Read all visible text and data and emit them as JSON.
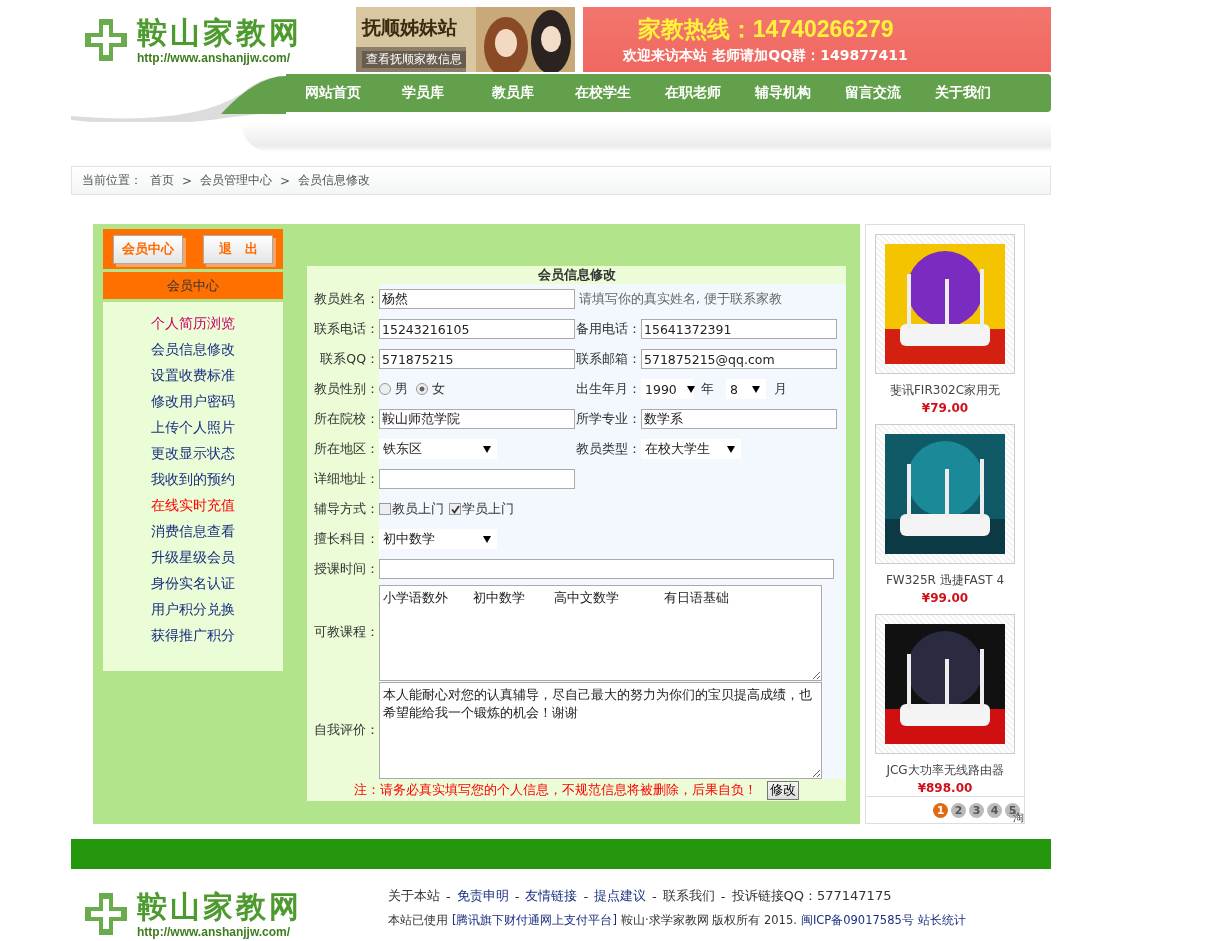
{
  "header": {
    "logo": {
      "title": "鞍山家教网",
      "url": "http://www.anshanjjw.com/"
    },
    "banners": [
      {
        "kind": "picture",
        "title": "抚顺姊妹站",
        "subtitle": "查看抚顺家教信息"
      },
      {
        "kind": "hotline",
        "title": "家教热线：14740266279",
        "subtitle": "欢迎来访本站 老师请加QQ群：149877411"
      }
    ]
  },
  "nav": [
    "网站首页",
    "学员库",
    "教员库",
    "在校学生",
    "在职老师",
    "辅导机构",
    "留言交流",
    "关于我们"
  ],
  "breadcrumb": {
    "prefix": "当前位置：",
    "separator": ">",
    "items": [
      "首页",
      "会员管理中心",
      "会员信息修改"
    ]
  },
  "member_menu": {
    "buttons": [
      "会员中心",
      "退　出"
    ],
    "title": "会员中心",
    "items": [
      {
        "label": "个人简历浏览",
        "color": "#cc0066"
      },
      {
        "label": "会员信息修改",
        "color": "#1a2f80"
      },
      {
        "label": "设置收费标准",
        "color": "#1a2f80"
      },
      {
        "label": "修改用户密码",
        "color": "#1a2f80"
      },
      {
        "label": "上传个人照片",
        "color": "#1a2f80"
      },
      {
        "label": "更改显示状态",
        "color": "#1a2f80"
      },
      {
        "label": "我收到的预约",
        "color": "#1a2f80"
      },
      {
        "label": "在线实时充值",
        "color": "#ff0000"
      },
      {
        "label": "消费信息查看",
        "color": "#1a2f80"
      },
      {
        "label": "升级星级会员",
        "color": "#1a2f80"
      },
      {
        "label": "身份实名认证",
        "color": "#1a2f80"
      },
      {
        "label": "用户积分兑换",
        "color": "#1a2f80"
      },
      {
        "label": "获得推广积分",
        "color": "#1a2f80"
      }
    ]
  },
  "form": {
    "title": "会员信息修改",
    "rows": [
      {
        "cells": [
          {
            "kind": "text",
            "label": "教员姓名：",
            "value": "杨然"
          },
          {
            "kind": "hint",
            "text": "请填写你的真实姓名, 便于联系家教"
          }
        ]
      },
      {
        "cells": [
          {
            "kind": "text",
            "label": "联系电话：",
            "value": "15243216105"
          },
          {
            "kind": "text",
            "label": "备用电话：",
            "value": "15641372391"
          }
        ]
      },
      {
        "cells": [
          {
            "kind": "text",
            "label": "联系QQ：",
            "value": "571875215"
          },
          {
            "kind": "text",
            "label": "联系邮箱：",
            "value": "571875215@qq.com"
          }
        ]
      },
      {
        "cells": [
          {
            "kind": "radio",
            "label": "教员性别：",
            "options": [
              {
                "label": "男",
                "selected": false
              },
              {
                "label": "女",
                "selected": true
              }
            ]
          },
          {
            "kind": "date",
            "label": "出生年月：",
            "year": "1990",
            "year_unit": "年",
            "month": "8",
            "month_unit": "月"
          }
        ]
      },
      {
        "cells": [
          {
            "kind": "text",
            "label": "所在院校：",
            "value": "鞍山师范学院"
          },
          {
            "kind": "text",
            "label": "所学专业：",
            "value": "数学系"
          }
        ]
      },
      {
        "cells": [
          {
            "kind": "select",
            "label": "所在地区：",
            "value": "铁东区"
          },
          {
            "kind": "select",
            "label": "教员类型：",
            "value": "在校大学生"
          }
        ]
      },
      {
        "cells": [
          {
            "kind": "text",
            "label": "详细地址："
          }
        ]
      },
      {
        "cells": [
          {
            "kind": "checkbox",
            "label": "辅导方式：",
            "options": [
              {
                "label": "教员上门",
                "checked": false
              },
              {
                "label": "学员上门",
                "checked": true
              }
            ]
          }
        ]
      },
      {
        "cells": [
          {
            "kind": "select",
            "label": "擅长科目：",
            "value": "初中数学"
          }
        ]
      },
      {
        "cells": [
          {
            "kind": "wide",
            "label": "授课时间："
          }
        ]
      },
      {
        "cells": [
          {
            "kind": "textarea",
            "label": "可教课程：",
            "value": "小学语数外      初中数学       高中文数学           有日语基础"
          }
        ]
      },
      {
        "cells": [
          {
            "kind": "textarea",
            "label": "自我评价：",
            "value": "本人能耐心对您的认真辅导，尽自己最大的努力为你们的宝贝提高成绩，也希望能给我一个锻炼的机会！谢谢"
          }
        ]
      }
    ],
    "note": "注：请务必真实填写您的个人信息，不规范信息将被删除，后果自负！",
    "submit": "修改"
  },
  "products": [
    {
      "kind": "picture",
      "name": "斐讯FIR302C家用无",
      "price": "¥79.00"
    },
    {
      "kind": "picture",
      "name": "FW325R 迅捷FAST 4",
      "price": "¥99.00"
    },
    {
      "kind": "picture",
      "name": "JCG大功率无线路由器",
      "price": "¥898.00"
    }
  ],
  "pager": {
    "pages": [
      {
        "label": "1",
        "selected": true
      },
      {
        "label": "2",
        "selected": false
      },
      {
        "label": "3",
        "selected": false
      },
      {
        "label": "4",
        "selected": false
      },
      {
        "label": "5",
        "selected": false
      }
    ],
    "badge": "淘"
  },
  "footer": {
    "logo": {
      "title": "鞍山家教网",
      "url": "http://www.anshanjjw.com/"
    },
    "links": [
      {
        "label": "关于本站",
        "kind": "text"
      },
      {
        "label": "免责申明",
        "kind": "link"
      },
      {
        "label": "友情链接",
        "kind": "link"
      },
      {
        "label": "提点建议",
        "kind": "link"
      },
      {
        "label": "联系我们",
        "kind": "text"
      },
      {
        "label": "投诉链接QQ：577147175",
        "kind": "text"
      }
    ],
    "separator": "-",
    "copyright": [
      {
        "label": "本站已使用",
        "kind": "text"
      },
      {
        "label": "[腾讯旗下财付通网上支付平台]",
        "kind": "link"
      },
      {
        "label": "鞍山·求学家教网 版权所有 2015.",
        "kind": "text"
      },
      {
        "label": "闽ICP备09017585号",
        "kind": "link"
      },
      {
        "label": "站长统计",
        "kind": "link"
      }
    ]
  }
}
